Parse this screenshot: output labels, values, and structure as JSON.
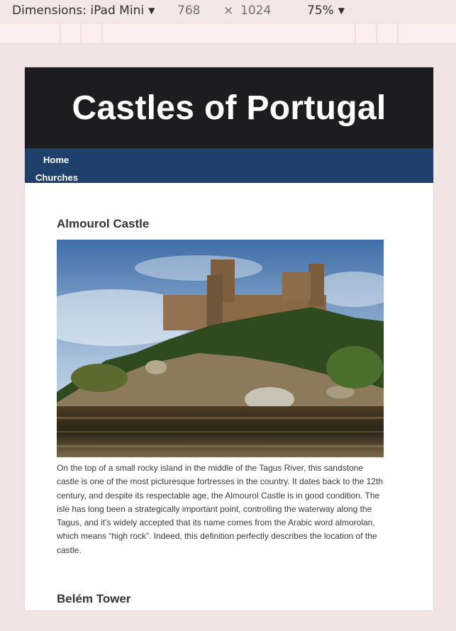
{
  "devtools": {
    "dimensions_label": "Dimensions: iPad Mini",
    "width": "768",
    "times": "×",
    "height": "1024",
    "zoom": "75%"
  },
  "site": {
    "title": "Castles of Portugal",
    "nav": [
      "Home",
      "Churches"
    ]
  },
  "articles": [
    {
      "heading": "Almourol Castle",
      "text": "On the top of a small rocky island in the middle of the Tagus River, this sandstone castle is one of the most picturesque fortresses in the country. It dates back to the 12th century, and despite its respectable age, the Almourol Castle is in good condition. The isle has long been a strategically important point, controlling the waterway along the Tagus, and it’s widely accepted that its name comes from the Arabic word almorolan, which means “high rock”. Indeed, this definition perfectly describes the location of the castle."
    },
    {
      "heading": "Belém Tower"
    }
  ]
}
